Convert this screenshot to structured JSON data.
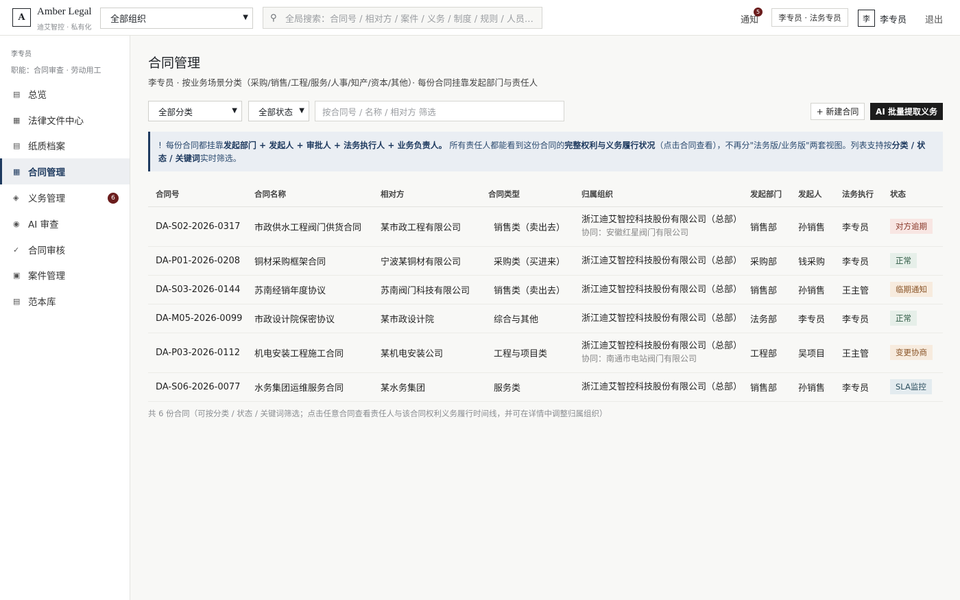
{
  "brand": {
    "logo_letter": "A",
    "name": "Amber Legal",
    "tagline": "迪艾智控 · 私有化"
  },
  "header": {
    "org_select": "全部组织",
    "search_placeholder": "全局搜索：合同号 / 相对方 / 案件 / 义务 / 制度 / 规则 / 人员…",
    "notify_label": "通知",
    "notify_count": "5",
    "role_chip": "李专员 · 法务专员",
    "avatar_letter": "李",
    "user_name": "李专员",
    "logout": "退出"
  },
  "sidebar": {
    "user": "李专员",
    "role": "职能：合同审查 · 劳动用工",
    "items": [
      {
        "label": "总览",
        "icon": "list-icon",
        "glyph": "▤"
      },
      {
        "label": "法律文件中心",
        "icon": "grid-icon",
        "glyph": "▦"
      },
      {
        "label": "纸质档案",
        "icon": "list-icon",
        "glyph": "▤"
      },
      {
        "label": "合同管理",
        "icon": "grid-icon",
        "glyph": "▦"
      },
      {
        "label": "义务管理",
        "icon": "diamond-icon",
        "glyph": "◈",
        "count": "6"
      },
      {
        "label": "AI 审查",
        "icon": "target-icon",
        "glyph": "◉"
      },
      {
        "label": "合同审核",
        "icon": "check-icon",
        "glyph": "✓"
      },
      {
        "label": "案件管理",
        "icon": "square-icon",
        "glyph": "▣"
      },
      {
        "label": "范本库",
        "icon": "list-icon",
        "glyph": "▤"
      }
    ]
  },
  "main": {
    "title": "合同管理",
    "subtitle": "李专员 · 按业务场景分类（采购/销售/工程/服务/人事/知产/资本/其他）· 每份合同挂靠发起部门与责任人",
    "filter_category": "全部分类",
    "filter_status": "全部状态",
    "filter_placeholder": "按合同号 / 名称 / 相对方 筛选",
    "new_button": "+ 新建合同",
    "ai_button": "AI 批量提取义务",
    "notice": {
      "p1": "每份合同都挂靠",
      "b1": "发起部门",
      "s1": " + ",
      "b2": "发起人",
      "s2": " + ",
      "b3": "审批人",
      "s3": " + ",
      "b4": "法务执行人",
      "s4": " + ",
      "b5": "业务负责人。",
      "p2": " 所有责任人都能看到这份合同的",
      "b6": "完整权利与义务履行状况",
      "p3": "（点击合同查看），不再分\"法务版/业务版\"两套视图。列表支持按",
      "b7": "分类 / 状态 / 关键词",
      "p4": "实时筛选。"
    },
    "columns": [
      "合同号",
      "合同名称",
      "相对方",
      "合同类型",
      "归属组织",
      "发起部门",
      "发起人",
      "法务执行",
      "状态"
    ],
    "rows": [
      {
        "id": "DA-S02-2026-0317",
        "name": "市政供水工程阀门供货合同",
        "party": "某市政工程有限公司",
        "type": "销售类（卖出去）",
        "org": "浙江迪艾智控科技股份有限公司（总部）",
        "co_org": "协同：安徽红星阀门有限公司",
        "dept": "销售部",
        "initiator": "孙销售",
        "legal": "李专员",
        "status": "对方逾期",
        "status_color": "#8a3a2c"
      },
      {
        "id": "DA-P01-2026-0208",
        "name": "铜材采购框架合同",
        "party": "宁波某铜材有限公司",
        "type": "采购类（买进来）",
        "org": "浙江迪艾智控科技股份有限公司（总部）",
        "co_org": "",
        "dept": "采购部",
        "initiator": "钱采购",
        "legal": "李专员",
        "status": "正常",
        "status_color": "#2f5a44"
      },
      {
        "id": "DA-S03-2026-0144",
        "name": "苏南经销年度协议",
        "party": "苏南阀门科技有限公司",
        "type": "销售类（卖出去）",
        "org": "浙江迪艾智控科技股份有限公司（总部）",
        "co_org": "",
        "dept": "销售部",
        "initiator": "孙销售",
        "legal": "王主管",
        "status": "临期通知",
        "status_color": "#8a5528"
      },
      {
        "id": "DA-M05-2026-0099",
        "name": "市政设计院保密协议",
        "party": "某市政设计院",
        "type": "综合与其他",
        "org": "浙江迪艾智控科技股份有限公司（总部）",
        "co_org": "",
        "dept": "法务部",
        "initiator": "李专员",
        "legal": "李专员",
        "status": "正常",
        "status_color": "#2f5a44"
      },
      {
        "id": "DA-P03-2026-0112",
        "name": "机电安装工程施工合同",
        "party": "某机电安装公司",
        "type": "工程与项目类",
        "org": "浙江迪艾智控科技股份有限公司（总部）",
        "co_org": "协同：南通市电站阀门有限公司",
        "dept": "工程部",
        "initiator": "吴项目",
        "legal": "王主管",
        "status": "变更协商",
        "status_color": "#8a5528"
      },
      {
        "id": "DA-S06-2026-0077",
        "name": "水务集团运维服务合同",
        "party": "某水务集团",
        "type": "服务类",
        "org": "浙江迪艾智控科技股份有限公司（总部）",
        "co_org": "",
        "dept": "销售部",
        "initiator": "孙销售",
        "legal": "李专员",
        "status": "SLA监控",
        "status_color": "#2c4f5f"
      }
    ],
    "footnote": "共 6 份合同（可按分类 / 状态 / 关键词筛选；点击任意合同查看责任人与该合同权利义务履行时间线，并可在详情中调整归属组织）"
  }
}
